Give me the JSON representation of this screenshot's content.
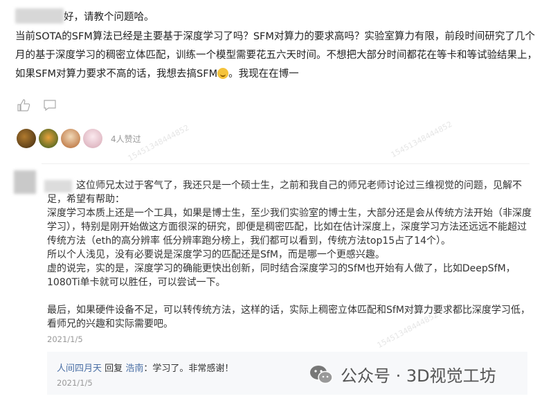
{
  "question": {
    "greeting": "好，请教个问题哈。",
    "body_before_emoji": "当前SOTA的SFM算法已经是主要基于深度学习了吗？SFM对算力的要求高吗？实验室算力有限，前段时间研究了几个月的基于深度学习的稠密立体匹配，训练一个模型需要花五六天时间。不想把大部分时间都花在等卡和等试验结果上，如果SFM对算力要求不高的话，我想去搞SFM",
    "body_after_emoji": "。我现在在博一"
  },
  "likes": {
    "text": "4人赞过"
  },
  "answer": {
    "intro": "这位师兄太过于客气了，我还只是一个硕士生，之前和我自己的师兄老师讨论过三维视觉的问题，见解不足，希望有帮助：",
    "p1": "深度学习本质上还是一个工具，如果是博士生，至少我们实验室的博士生，大部分还是会从传统方法开始（非深度学习），特别是刚开始做这方面很深的研究，即便是稠密匹配，比如在估计深度上，深度学习方法还远远不能超过传统方法（eth的高分辨率 低分辨率跑分榜上，我们都可以看到，传统方法top15占了14个）。",
    "p2": "所以个人浅见，没有必要说是深度学习的匹配还是SfM，而是哪一个更感兴趣。",
    "p3": "虚的说完，实的是，深度学习的确能更快出创新，同时结合深度学习的SfM也开始有人做了，比如DeepSfM，1080Ti单卡就可以胜任，可以尝试一下。",
    "p4": "最后，如果硬件设备不足，可以转传统方法，这样的话，实际上稠密立体匹配和SfM对算力要求都比深度学习低，看师兄的兴趣和实际需要吧。",
    "date": "2021/1/5"
  },
  "reply": {
    "author": "人间四月天",
    "verb": "回复",
    "target": "浩南",
    "text": "：学习了。非常感谢！",
    "date": "2021/1/5"
  },
  "watermark": {
    "label": "公众号 · 3D视觉工坊",
    "stamp": "15451348444852"
  },
  "colors": {
    "link": "#4a6fa5",
    "muted": "#999999"
  },
  "icons": [
    "like-icon",
    "comment-icon",
    "wechat-icon"
  ]
}
